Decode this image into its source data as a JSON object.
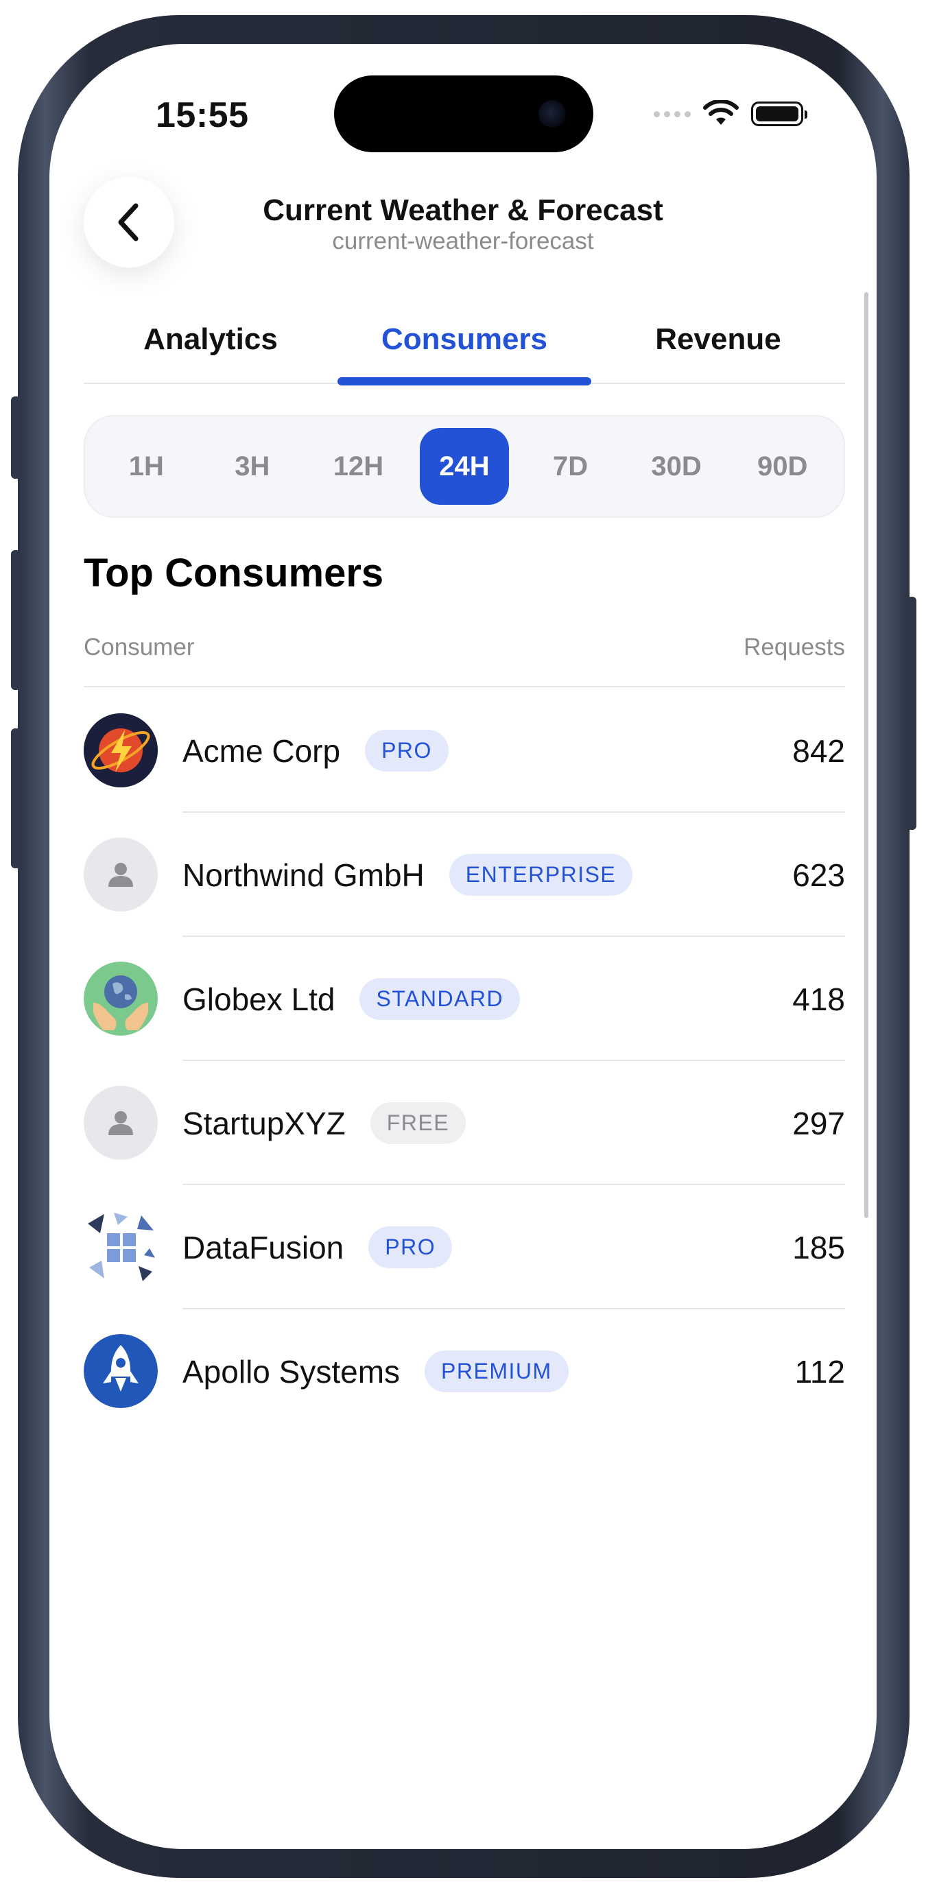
{
  "status": {
    "time": "15:55"
  },
  "header": {
    "title": "Current Weather & Forecast",
    "subtitle": "current-weather-forecast"
  },
  "tabs": [
    {
      "label": "Analytics",
      "active": false
    },
    {
      "label": "Consumers",
      "active": true
    },
    {
      "label": "Revenue",
      "active": false
    }
  ],
  "ranges": [
    "1H",
    "3H",
    "12H",
    "24H",
    "7D",
    "30D",
    "90D"
  ],
  "selected_range": "24H",
  "section": {
    "title": "Top Consumers",
    "col_consumer": "Consumer",
    "col_requests": "Requests"
  },
  "consumers": [
    {
      "name": "Acme Corp",
      "tier": "PRO",
      "requests": "842",
      "avatar": "lightning-logo"
    },
    {
      "name": "Northwind GmbH",
      "tier": "ENTERPRISE",
      "requests": "623",
      "avatar": "person-placeholder"
    },
    {
      "name": "Globex Ltd",
      "tier": "STANDARD",
      "requests": "418",
      "avatar": "globe-hands-logo"
    },
    {
      "name": "StartupXYZ",
      "tier": "FREE",
      "requests": "297",
      "avatar": "person-placeholder"
    },
    {
      "name": "DataFusion",
      "tier": "PRO",
      "requests": "185",
      "avatar": "geometric-grid-logo"
    },
    {
      "name": "Apollo Systems",
      "tier": "PREMIUM",
      "requests": "112",
      "avatar": "rocket-logo"
    }
  ],
  "colors": {
    "accent": "#2452d6",
    "badge_bg": "#e3e9fb",
    "muted": "#8a8a8f"
  }
}
